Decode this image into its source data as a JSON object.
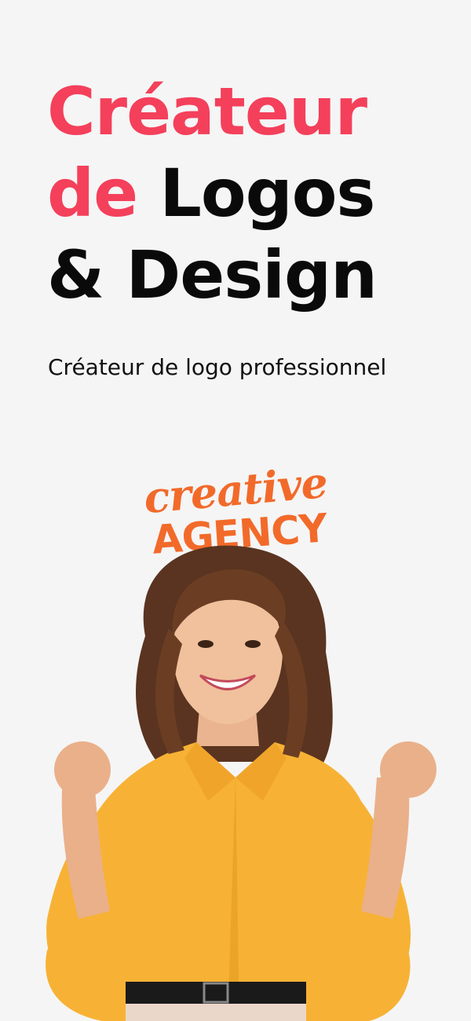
{
  "headline": {
    "line1_accent": "Créateur",
    "line2_accent": "de",
    "line2_rest": "Logos",
    "line3": "& Design"
  },
  "subtitle": "Créateur de logo professionnel",
  "hero": {
    "logo_script": "creative",
    "logo_caps": "AGENCY"
  },
  "colors": {
    "accent": "#f4405b",
    "text": "#0a0a0a",
    "background": "#f5f5f5",
    "logo_orange": "#f26a2a",
    "shirt_yellow": "#f7b235"
  }
}
